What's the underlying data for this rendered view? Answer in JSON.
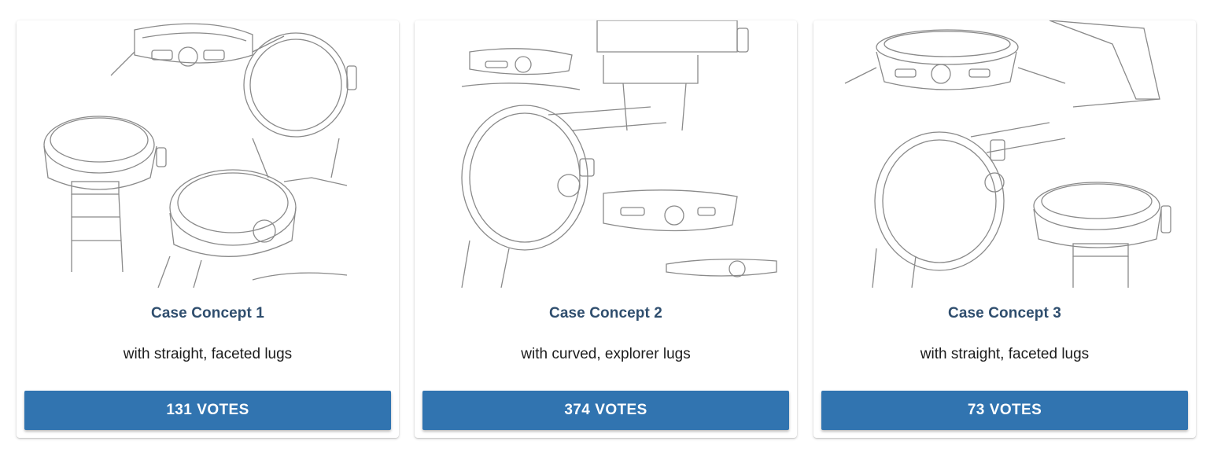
{
  "cards": [
    {
      "title": "Case Concept 1",
      "description": "with straight, faceted lugs",
      "votes": "131",
      "votes_label": "VOTES",
      "image_icon": "watch-sketch-icon"
    },
    {
      "title": "Case Concept 2",
      "description": "with curved, explorer lugs",
      "votes": "374",
      "votes_label": "VOTES",
      "image_icon": "watch-sketch-icon"
    },
    {
      "title": "Case Concept 3",
      "description": "with straight, faceted lugs",
      "votes": "73",
      "votes_label": "VOTES",
      "image_icon": "watch-sketch-icon"
    }
  ],
  "colors": {
    "button": "#3174b0",
    "title": "#2f4e6e",
    "sketch_stroke": "#8a8a8a"
  }
}
